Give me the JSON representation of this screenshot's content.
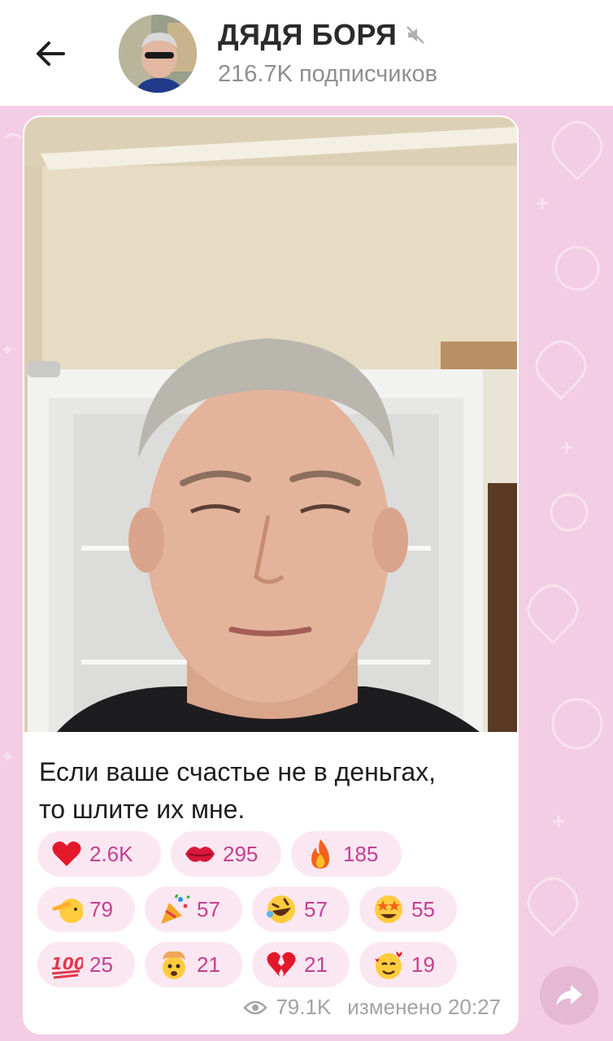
{
  "header": {
    "title": "ДЯДЯ БОРЯ",
    "subtitle": "216.7K подписчиков",
    "back_icon": "arrow-left-icon",
    "mute_icon": "muted-speaker-icon"
  },
  "message": {
    "caption_line1": "Если ваше счастье не в деньгах,",
    "caption_line2": "то шлите их мне.",
    "reactions": [
      {
        "emoji": "heart",
        "count": "2.6K"
      },
      {
        "emoji": "kiss",
        "count": "295"
      },
      {
        "emoji": "fire",
        "count": "185"
      },
      {
        "emoji": "salute",
        "count": "79"
      },
      {
        "emoji": "party",
        "count": "57"
      },
      {
        "emoji": "rofl",
        "count": "57"
      },
      {
        "emoji": "star-struck",
        "count": "55"
      },
      {
        "emoji": "hundred",
        "count": "25"
      },
      {
        "emoji": "exploding-head",
        "count": "21"
      },
      {
        "emoji": "broken-heart",
        "count": "21"
      },
      {
        "emoji": "smiling-hearts",
        "count": "19"
      }
    ],
    "views": "79.1K",
    "edited_time": "изменено 20:27"
  },
  "colors": {
    "accent": "#c33f8f",
    "reaction_bg": "#fbe7f2",
    "chat_bg": "#f3cde3"
  }
}
